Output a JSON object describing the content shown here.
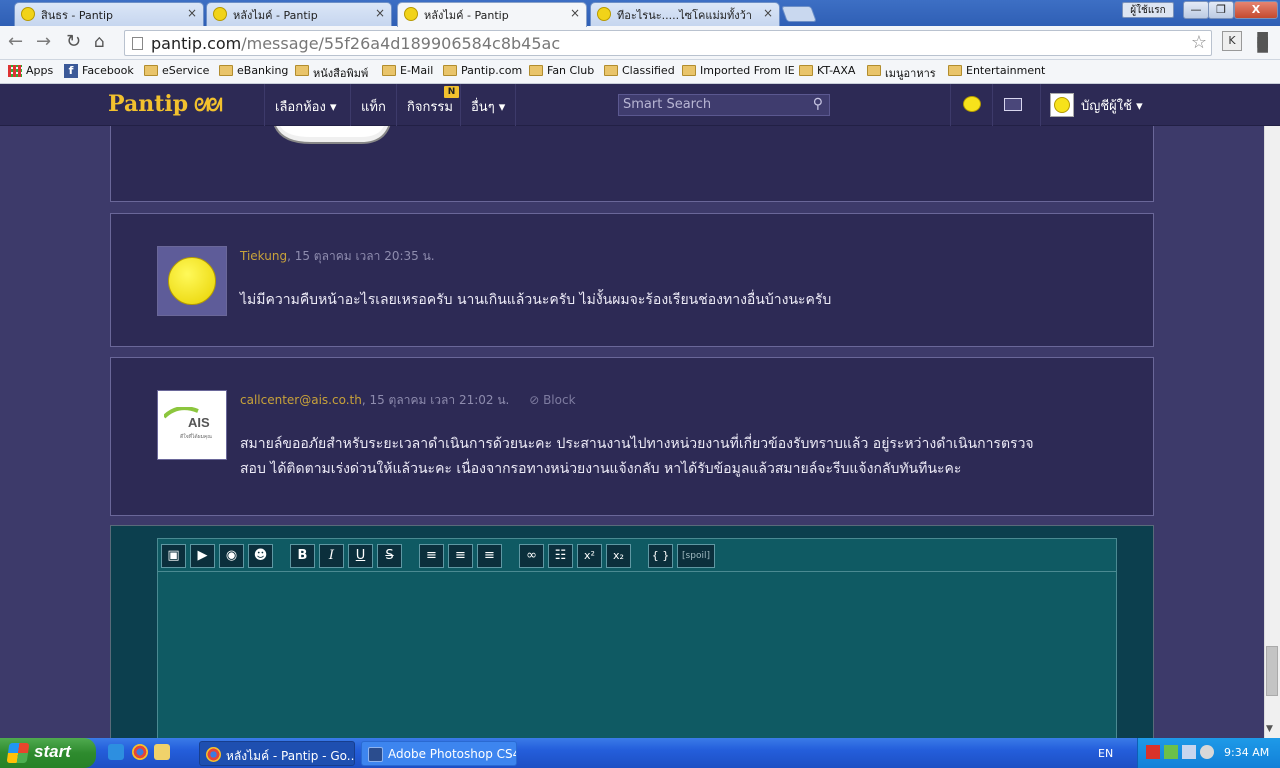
{
  "browser": {
    "tabs": [
      {
        "title": "สินธร - Pantip",
        "active": false
      },
      {
        "title": "หลังไมค์ - Pantip",
        "active": false
      },
      {
        "title": "หลังไมค์ - Pantip",
        "active": true
      },
      {
        "title": "ทีอะไรนะ.....ไซโคแม่มทั้งว้า",
        "active": false
      }
    ],
    "close_glyph": "×",
    "user_label": "ผู้ใช้แรก",
    "window_controls": {
      "minimize": "—",
      "maximize": "❐",
      "close": "X"
    },
    "url_host": "pantip.com",
    "url_path": "/message/55f26a4d189906584c8b45ac",
    "extension_label": "K"
  },
  "bookmarks": [
    {
      "label": "Apps",
      "icon": "apps-icon"
    },
    {
      "label": "Facebook",
      "icon": "facebook-icon"
    },
    {
      "label": "eService",
      "icon": "folder-icon"
    },
    {
      "label": "eBanking",
      "icon": "folder-icon"
    },
    {
      "label": "หนังสือพิมพ์",
      "icon": "folder-icon"
    },
    {
      "label": "E-Mail",
      "icon": "folder-icon"
    },
    {
      "label": "Pantip.com",
      "icon": "folder-icon"
    },
    {
      "label": "Fan Club",
      "icon": "folder-icon"
    },
    {
      "label": "Classified",
      "icon": "folder-icon"
    },
    {
      "label": "Imported From IE",
      "icon": "folder-icon"
    },
    {
      "label": "KT-AXA",
      "icon": "folder-icon"
    },
    {
      "label": "เมนูอาหาร",
      "icon": "folder-icon"
    },
    {
      "label": "Entertainment",
      "icon": "folder-icon"
    }
  ],
  "site": {
    "logo": "Pantip",
    "nav": {
      "rooms": "เลือกห้อง ▾",
      "tags": "แท็ก",
      "activities": "กิจกรรม",
      "activities_badge": "N",
      "more": "อื่นๆ ▾"
    },
    "search_placeholder": "Smart Search",
    "account_label": "บัญชีผู้ใช้ ▾",
    "accent": "#f2c12e"
  },
  "messages": [
    {
      "author": "Tiekung",
      "timestamp": ", 15 ตุลาคม เวลา 20:35 น.",
      "text": "ไม่มีความคืบหน้าอะไรเลยเหรอครับ นานเกินแล้วนะครับ ไม่งั้นผมจะร้องเรียนช่องทางอื่นบ้างนะครับ"
    },
    {
      "author": "callcenter@ais.co.th",
      "timestamp": ", 15 ตุลาคม เวลา 21:02 น.",
      "block_label": "Block",
      "avatar_text": "AIS",
      "avatar_subtext": "ดีใจที่ได้ผมคุณ",
      "text_line1": "สมายล์ขออภัยสำหรับระยะเวลาดำเนินการด้วยนะคะ ประสานงานไปทางหน่วยงานที่เกี่ยวข้องรับทราบแล้ว อยู่ระหว่างดำเนินการตรวจ",
      "text_line2": "สอบ  ได้ติดตามเร่งด่วนให้แล้วนะคะ  เนื่องจากรอทางหน่วยงานแจ้งกลับ  หาได้รับข้อมูลแล้วสมายล์จะรีบแจ้งกลับทันทีนะคะ"
    }
  ],
  "editor_toolbar": {
    "bold": "B",
    "italic": "I",
    "underline": "U",
    "strike": "S",
    "superscript": "x²",
    "subscript": "x₂",
    "code": "{ }",
    "spoil": "[spoil]"
  },
  "taskbar": {
    "start_label": "start",
    "tasks": [
      {
        "label": "หลังไมค์ - Pantip - Go...",
        "active": true
      },
      {
        "label": "Adobe Photoshop CS4",
        "active": false
      }
    ],
    "language": "EN",
    "clock": "9:34 AM"
  }
}
